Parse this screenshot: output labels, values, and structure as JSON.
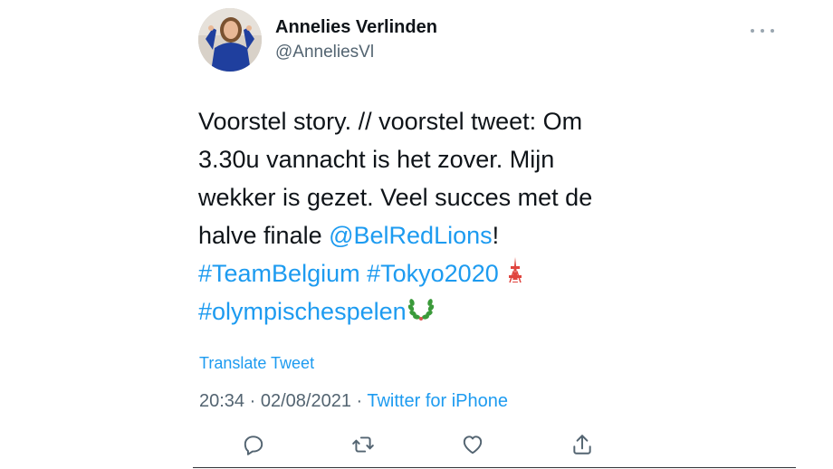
{
  "author": {
    "name": "Annelies Verlinden",
    "handle": "@AnneliesVl"
  },
  "tweet": {
    "lines": [
      [
        {
          "text": "Voorstel story. // voorstel tweet: Om",
          "link": false
        }
      ],
      [
        {
          "text": "3.30u vannacht is het zover. Mijn",
          "link": false
        }
      ],
      [
        {
          "text": "wekker is gezet. Veel succes met de",
          "link": false
        }
      ],
      [
        {
          "text": "halve finale ",
          "link": false
        },
        {
          "text": "@BelRedLions",
          "link": true
        },
        {
          "text": "!",
          "link": false
        }
      ],
      [
        {
          "text": "#TeamBelgium",
          "link": true
        },
        {
          "text": " ",
          "link": false
        },
        {
          "text": "#Tokyo2020",
          "link": true
        },
        {
          "text": " ",
          "link": false
        },
        {
          "emoji": "tokyo-tower-emoji"
        }
      ],
      [
        {
          "text": "#olympischespelen",
          "link": true
        },
        {
          "emoji": "laurel-wreath-emoji"
        }
      ]
    ]
  },
  "translate_label": "Translate Tweet",
  "meta": {
    "time": "20:34",
    "separator": " · ",
    "date": "02/08/2021",
    "source": "Twitter for iPhone"
  },
  "actions": [
    {
      "name": "reply-icon"
    },
    {
      "name": "retweet-icon"
    },
    {
      "name": "like-icon"
    },
    {
      "name": "share-icon"
    }
  ],
  "colors": {
    "link": "#1d9bf0",
    "text": "#0f1419",
    "secondary": "#536471"
  }
}
